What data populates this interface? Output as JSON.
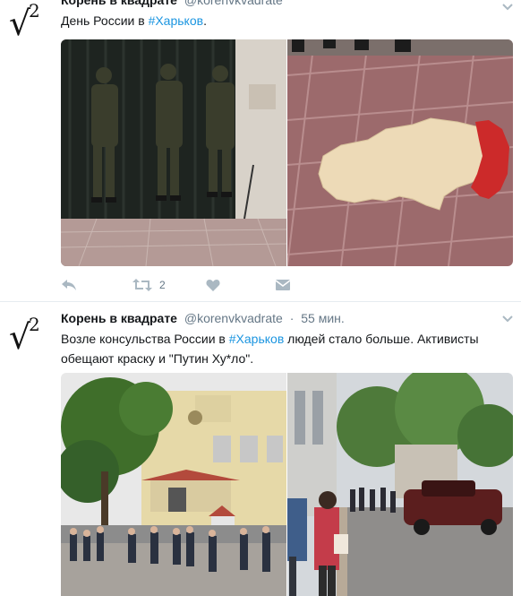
{
  "tweet1": {
    "author_name_cut": "Корень в квадрате",
    "handle_cut": "@korenvkvadrate",
    "text_prefix": "День России в ",
    "hashtag": "#Харьков",
    "text_suffix": ".",
    "retweet_count": "2",
    "icons": [
      "reply-icon",
      "retweet-icon",
      "like-icon",
      "dm-icon",
      "chevron-down-icon"
    ]
  },
  "tweet2": {
    "author_name": "Корень в квадрате",
    "handle": "@korenvkvadrate",
    "separator": "·",
    "time": "55 мин.",
    "text_part1": "Возле консульства России в ",
    "hashtag": "#Харьков",
    "text_part2": " людей стало больше. Активисты обещают краску и \"Путин Ху*ло\"."
  },
  "avatar": {
    "root_symbol": "√",
    "exponent": "2"
  },
  "colors": {
    "link": "#1b95e0",
    "muted": "#657786",
    "text": "#14171a",
    "divider": "#e6ecf0"
  }
}
